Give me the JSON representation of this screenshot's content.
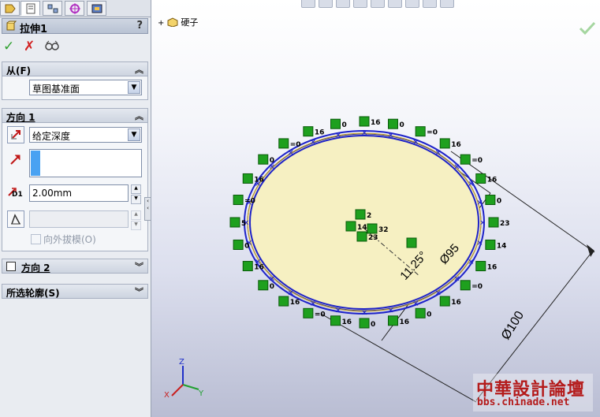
{
  "feature": {
    "title": "拉伸1",
    "help": "?"
  },
  "actions": {
    "ok": "✓",
    "cancel": "✗",
    "preview": "66"
  },
  "sections": {
    "from": {
      "header": "从(F)",
      "value": "草图基准面"
    },
    "direction1": {
      "header": "方向 1",
      "end_condition": "给定深度",
      "depth_label": "D1",
      "depth": "2.00mm",
      "draft_outward": "向外拔模(O)"
    },
    "direction2": {
      "header": "方向 2"
    },
    "contours": {
      "header": "所选轮廓(S)"
    }
  },
  "tree": {
    "part_name": "硬子"
  },
  "dimensions": {
    "d1": "11.25°",
    "d2": "Ø95",
    "d3": "Ø100"
  },
  "watermark": {
    "title": "中華設計論壇",
    "url": "bbs.chinade.net"
  },
  "colors": {
    "accent_green": "#2ea02e",
    "cancel_red": "#d21e1e",
    "relation_green": "#1ea01e",
    "sketch_blue": "#1e22c8",
    "face_fill": "#f6f0c2"
  },
  "relation_labels": {
    "eq": "=0",
    "n16": "16",
    "n0": "0",
    "n23": "23",
    "n14": "14",
    "n2": "2",
    "n32": "32",
    "n5": "5"
  }
}
